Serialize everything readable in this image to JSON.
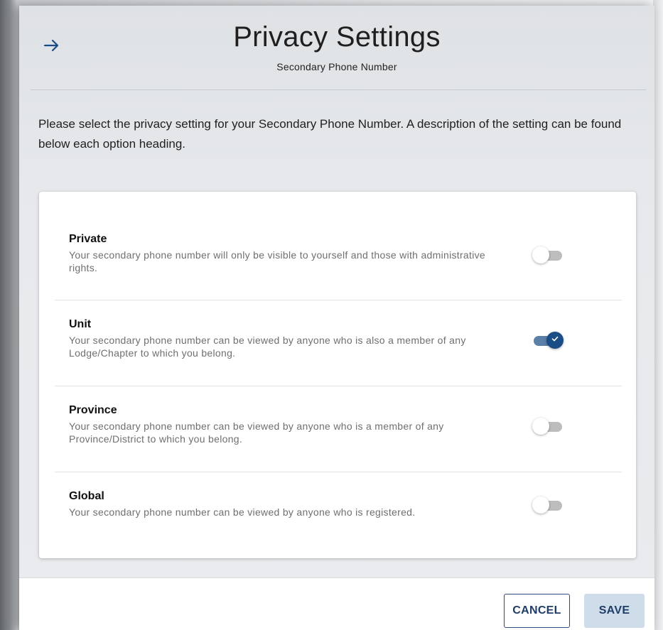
{
  "header": {
    "title": "Privacy Settings",
    "subtitle": "Secondary Phone Number",
    "back_icon": "arrow-right-icon"
  },
  "description": "Please select the privacy setting for your Secondary Phone Number. A description of the setting can be found below each option heading.",
  "options": [
    {
      "title": "Private",
      "description": "Your secondary phone number will only be visible to yourself and those with administrative rights.",
      "enabled": false
    },
    {
      "title": "Unit",
      "description": "Your secondary phone number can be viewed by anyone who is also a member of any Lodge/Chapter to which you belong.",
      "enabled": true
    },
    {
      "title": "Province",
      "description": "Your secondary phone number can be viewed by anyone who is a member of any Province/District to which you belong.",
      "enabled": false
    },
    {
      "title": "Global",
      "description": "Your secondary phone number can be viewed by anyone who is registered.",
      "enabled": false
    }
  ],
  "footer": {
    "cancel_label": "CANCEL",
    "save_label": "SAVE"
  },
  "colors": {
    "accent": "#1a4c86",
    "toggle_on_track": "#5c7fa8",
    "save_bg": "#cfdcea"
  }
}
